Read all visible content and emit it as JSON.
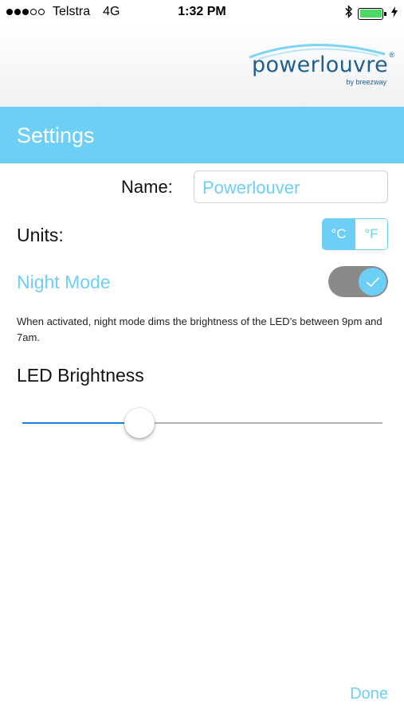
{
  "status_bar": {
    "carrier": "Telstra",
    "network": "4G",
    "time": "1:32 PM",
    "signal_dots_filled": 3,
    "signal_dots_total": 5,
    "battery_level": 1.0,
    "icons": [
      "bluetooth-icon",
      "battery-icon",
      "charging-bolt-icon"
    ]
  },
  "brand": {
    "logo_word": "powerlouvre",
    "logo_registered": "®",
    "logo_sub": "by breezway",
    "color": "#1f5f8b"
  },
  "header": {
    "title": "Settings"
  },
  "settings": {
    "name_label": "Name:",
    "name_value": "Powerlouver",
    "units_label": "Units:",
    "units_options": [
      "°C",
      "°F"
    ],
    "units_selected": "°C",
    "night_mode_label": "Night Mode",
    "night_mode_on": true,
    "night_mode_description": "When activated, night mode dims the brightness of the LED’s between 9pm and 7am.",
    "led_label": "LED Brightness",
    "led_brightness": 0.31
  },
  "footer": {
    "done_label": "Done"
  },
  "colors": {
    "accent": "#6dcff6",
    "slider_fill": "#1a7fe0",
    "toggle_track": "#8a8a8a"
  }
}
